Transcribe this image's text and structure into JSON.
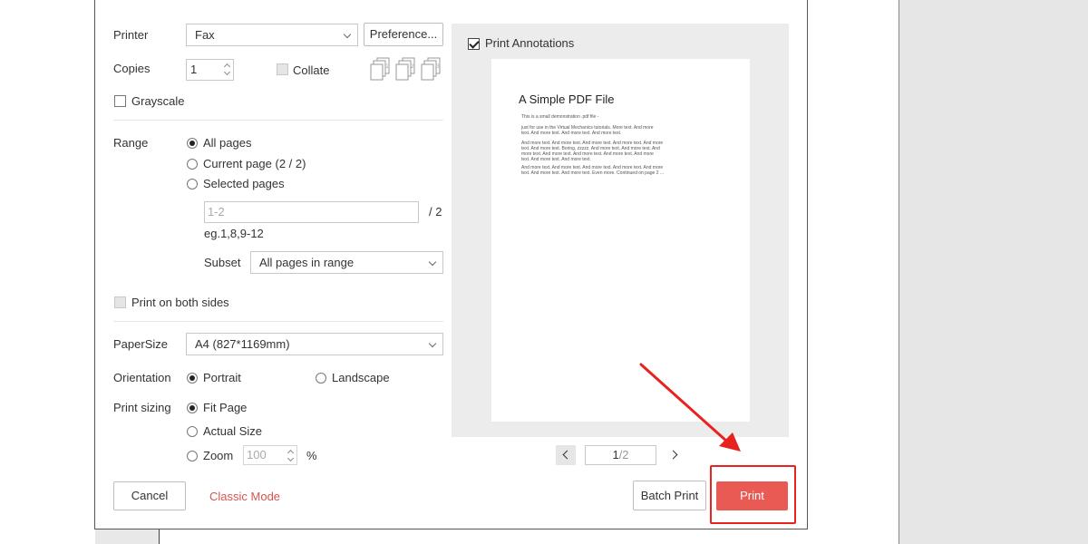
{
  "dialog": {
    "printer_label": "Printer",
    "printer_value": "Fax",
    "preferences_label": "Preference...",
    "copies_label": "Copies",
    "copies_value": "1",
    "collate_label": "Collate",
    "grayscale_label": "Grayscale",
    "range_label": "Range",
    "range_options": [
      "All pages",
      "Current page (2 / 2)",
      "Selected pages"
    ],
    "range_selected": "All pages",
    "pages_placeholder": "1-2",
    "pages_total": "/ 2",
    "pages_hint": "eg.1,8,9-12",
    "subset_label": "Subset",
    "subset_value": "All pages in range",
    "both_sides_label": "Print on both sides",
    "papersize_label": "PaperSize",
    "papersize_value": "A4 (827*1169mm)",
    "orientation_label": "Orientation",
    "orientation_options": [
      "Portrait",
      "Landscape"
    ],
    "orientation_selected": "Portrait",
    "sizing_label": "Print sizing",
    "sizing_options": [
      "Fit Page",
      "Actual Size",
      "Zoom"
    ],
    "sizing_selected": "Fit Page",
    "zoom_value": "100",
    "zoom_unit": "%",
    "print_annotations_label": "Print Annotations",
    "print_annotations_checked": true,
    "preview": {
      "title": "A Simple PDF File",
      "lines_1": [
        "This is a small demonstration .pdf file -"
      ],
      "lines_2": [
        "just for use in the Virtual Mechanics tutorials. More text. And more",
        "text. And more text. And more text. And more text."
      ],
      "lines_3": [
        "And more text. And more text. And more text. And more text. And more",
        "text. And more text. Boring, zzzzz. And more text. And more text. And",
        "more text. And more text. And more text. And more text. And more",
        "text. And more text. And more text."
      ],
      "lines_4": [
        "And more text. And more text. And more text. And more text. And more",
        "text. And more text. And more text. Even more. Continued on page 2 ..."
      ]
    },
    "pager_current": "1",
    "pager_total": "/2",
    "cancel_label": "Cancel",
    "classic_mode_label": "Classic Mode",
    "batch_print_label": "Batch Print",
    "print_label": "Print"
  },
  "colors": {
    "accent_red": "#ea5a55",
    "annotation_red": "#e8231f",
    "classic_mode": "#d9534f"
  },
  "icons": {
    "collate": "collate-pages-icon",
    "pager_prev": "chevron-left-icon",
    "pager_next": "chevron-right-icon",
    "annotation_arrow": "red-arrow-annotation"
  }
}
